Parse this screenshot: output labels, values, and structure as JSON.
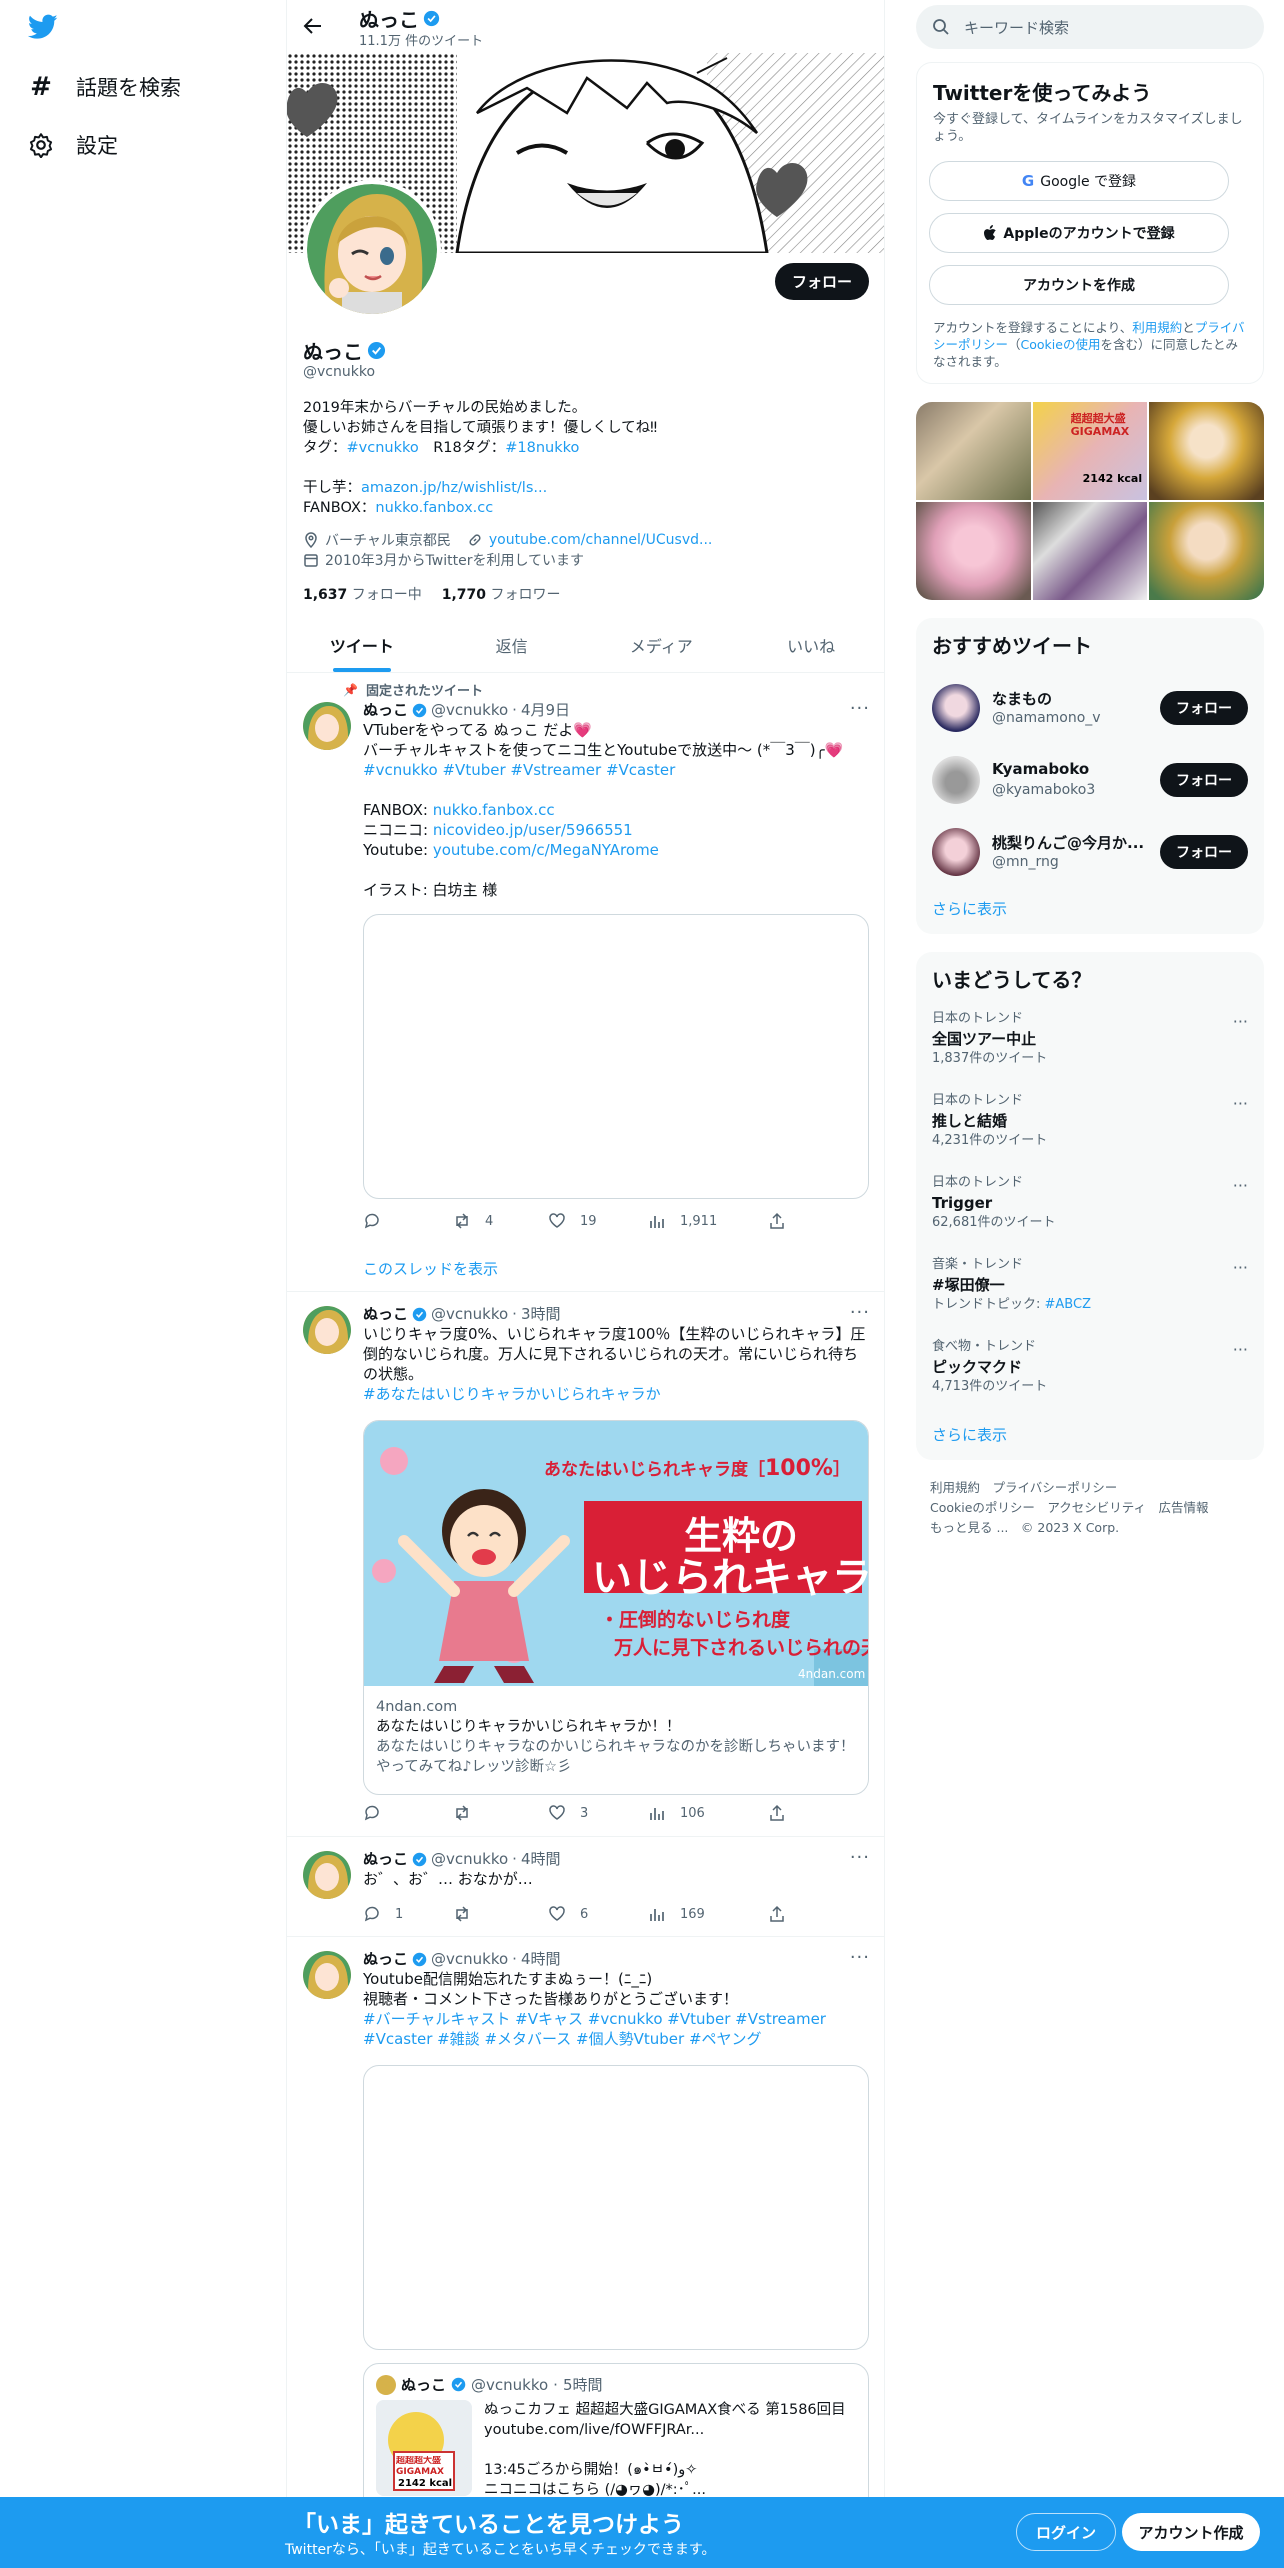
{
  "nav": {
    "search_label": "話題を検索",
    "settings_label": "設定"
  },
  "header": {
    "name": "ぬっこ",
    "tweet_count": "11.1万 件のツイート"
  },
  "profile": {
    "follow_label": "フォロー",
    "name": "ぬっこ",
    "handle": "@vcnukko",
    "bio_line1": "2019年末からバーチャルの民始めました。",
    "bio_line2": "優しいお姉さんを目指して頑張ります！優しくしてね‼",
    "tags_prefix": "タグ：",
    "tag1": "#vcnukko",
    "tags_mid": "　R18タグ：",
    "tag2": "#18nukko",
    "hoshii_label": "干し芋：",
    "hoshii_link": "amazon.jp/hz/wishlist/ls...",
    "fanbox_label": "FANBOX：",
    "fanbox_link": "nukko.fanbox.cc",
    "location": "バーチャル東京都民",
    "url": "youtube.com/channel/UCusvd...",
    "joined": "2010年3月からTwitterを利用しています",
    "following_count": "1,637",
    "following_label": "フォロー中",
    "followers_count": "1,770",
    "followers_label": "フォロワー"
  },
  "tabs": [
    "ツイート",
    "返信",
    "メディア",
    "いいね"
  ],
  "tweets": [
    {
      "pinned_label": "固定されたツイート",
      "name": "ぬっこ",
      "handle": "@vcnukko",
      "time": "4月9日",
      "line1": "VTuberをやってる ぬっこ だよ💗",
      "line2": "バーチャルキャストを使ってニコ生とYoutubeで放送中～ (*￣3￣)╭💗",
      "tags": "#vcnukko #Vtuber #Vstreamer #Vcaster",
      "fanbox_label": "FANBOX: ",
      "fanbox_link": "nukko.fanbox.cc",
      "nico_label": "ニコニコ: ",
      "nico_link": "nicovideo.jp/user/5966551",
      "yt_label": "Youtube: ",
      "yt_link": "youtube.com/c/MegaNYArome",
      "illust": "イラスト: 白坊主 様",
      "replies": "",
      "retweets": "4",
      "likes": "19",
      "views": "1,911",
      "thread_link": "このスレッドを表示"
    },
    {
      "name": "ぬっこ",
      "handle": "@vcnukko",
      "time": "3時間",
      "text": "いじりキャラ度0%、いじられキャラ度100％【生粋のいじられキャラ】圧倒的ないじられ度。万人に見下されるいじられの天才。常にいじられ待ちの状態。",
      "tags": "#あなたはいじりキャラかいじられキャラか",
      "card_banner": "あなたはいじられキャラ度",
      "card_percent": "100%",
      "card_title1": "生粋の",
      "card_title2": "いじられキャラ",
      "card_sub1": "・圧倒的ないじられ度",
      "card_sub2": "万人に見下されるいじられの天才",
      "card_watermark": "4ndan.com",
      "card_domain": "4ndan.com",
      "card_title": "あなたはいじりキャラかいじられキャラか！！",
      "card_desc": "あなたはいじりキャラなのかいじられキャラなのかを診断しちゃいます！やってみてね♪レッツ診断☆彡",
      "replies": "",
      "retweets": "",
      "likes": "3",
      "views": "106"
    },
    {
      "name": "ぬっこ",
      "handle": "@vcnukko",
      "time": "4時間",
      "text": "お゛、お゛… おなかが…",
      "replies": "1",
      "retweets": "",
      "likes": "6",
      "views": "169"
    },
    {
      "name": "ぬっこ",
      "handle": "@vcnukko",
      "time": "4時間",
      "line1": "Youtube配信開始忘れたすまぬぅー！(ﾆ_ﾆ)",
      "line2": "視聴者・コメント下さった皆様ありがとうございます！",
      "tags1": "#バーチャルキャスト #Vキャス #vcnukko #Vtuber #Vstreamer",
      "tags2": "#Vcaster #雑談 #メタバース #個人勢Vtuber #ペヤング",
      "quote": {
        "name": "ぬっこ",
        "handle": "@vcnukko",
        "time": "5時間",
        "line1": "ぬっこカフェ 超超超大盛GIGAMAX食べる 第1586回目",
        "line2": "youtube.com/live/fOWFFJRAr...",
        "line3": "13:45ごろから開始！(๑•̀ㅂ•́)و✧",
        "line4": "ニコニコはこちら (/◕ヮ◕)/*:･ﾟ..."
      }
    }
  ],
  "sidebar": {
    "search_placeholder": "キーワード検索",
    "signup_title": "Twitterを使ってみよう",
    "signup_sub": "今すぐ登録して、タイムラインをカスタマイズしましょう。",
    "google_label": "Google で登録",
    "apple_label": "Appleのアカウントで登録",
    "create_label": "アカウントを作成",
    "terms_pre": "アカウントを登録することにより、",
    "terms_link1": "利用規約",
    "terms_mid": "と",
    "terms_link2": "プライバシーポリシー",
    "terms_mid2": "（",
    "terms_link3": "Cookieの使用",
    "terms_post": "を含む）に同意したとみなされます。",
    "thumb_text": "超超超大盛GIGAMAX",
    "thumb_kcal": "2142 kcal",
    "recommend_title": "おすすめツイート",
    "recommend": [
      {
        "name": "なまもの",
        "handle": "@namamono_v"
      },
      {
        "name": "Kyamaboko",
        "handle": "@kyamaboko3"
      },
      {
        "name": "桃梨りんご@今月か...",
        "handle": "@mn_rng"
      }
    ],
    "recommend_follow": "フォロー",
    "recommend_more": "さらに表示",
    "trends_title": "いまどうしてる？",
    "trends": [
      {
        "cat": "日本のトレンド",
        "name": "全国ツアー中止",
        "cnt": "1,837件のツイート"
      },
      {
        "cat": "日本のトレンド",
        "name": "推しと結婚",
        "cnt": "4,231件のツイート"
      },
      {
        "cat": "日本のトレンド",
        "name": "Trigger",
        "cnt": "62,681件のツイート"
      },
      {
        "cat": "音楽・トレンド",
        "name": "#塚田僚一",
        "cnt_pre": "トレンドトピック: ",
        "cnt_link": "#ABCZ"
      },
      {
        "cat": "食べ物・トレンド",
        "name": "ピックマクド",
        "cnt": "4,713件のツイート"
      }
    ],
    "trends_more": "さらに表示",
    "footer1": "利用規約　プライバシーポリシー",
    "footer2": "Cookieのポリシー　アクセシビリティ　広告情報",
    "footer3": "もっと見る ...　© 2023 X Corp."
  },
  "bottombar": {
    "title": "「いま」起きていることを見つけよう",
    "sub": "Twitterなら、「いま」起きていることをいち早くチェックできます。",
    "login": "ログイン",
    "signup": "アカウント作成"
  },
  "colors": {
    "accent": "#1d9bf0",
    "text": "#0f1419",
    "muted": "#536471"
  }
}
